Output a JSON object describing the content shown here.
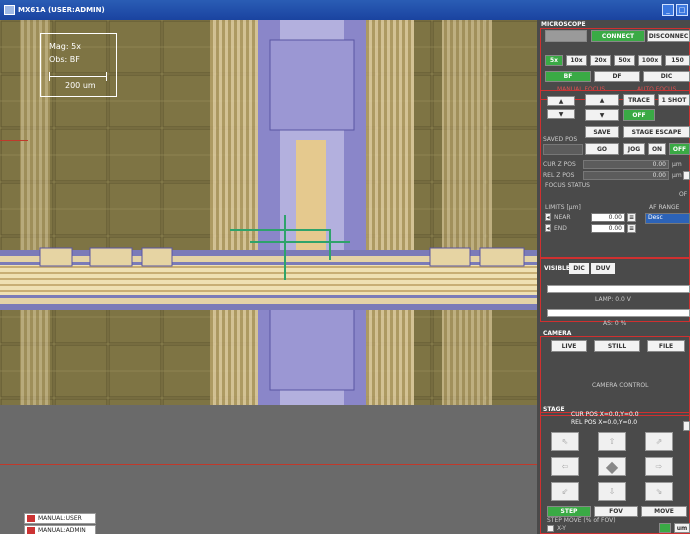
{
  "window": {
    "title": "MX61A (USER:ADMIN)",
    "buttons": [
      "_",
      "□"
    ]
  },
  "overlay": {
    "mag": "Mag: 5x",
    "obs": "Obs: BF",
    "scale": "200  um"
  },
  "modes": [
    "MANUAL:USER",
    "MANUAL:ADMIN"
  ],
  "microscope": {
    "title": "MICROSCOPE",
    "connect": "CONNECT",
    "disconnect": "DISCONNEC",
    "mags": [
      "5x",
      "10x",
      "20x",
      "50x",
      "100x",
      "150"
    ],
    "obs": [
      "BF",
      "DF",
      "DIC"
    ],
    "manual_focus": "MANUAL FOCUS",
    "auto_focus": "AUTO FOCUS",
    "trace": "TRACE",
    "one_shot": "1 SHOT",
    "off": "OFF",
    "saved_pos": "SAVED POS",
    "save": "SAVE",
    "stage_escape": "STAGE ESCAPE",
    "go": "GO",
    "jog": "JOG",
    "on": "ON",
    "off2": "OFF",
    "cur_z_pos": "CUR Z POS",
    "rel_z_pos": "REL Z POS",
    "cur_z_val": "0.00",
    "rel_z_val": "0.00",
    "unit": "µm",
    "focus_status": "FOCUS STATUS",
    "focus_status_val": "OF",
    "limits": "LIMITS [µm]",
    "near": "NEAR",
    "end": "END",
    "near_val": "0.00",
    "end_val": "0.00",
    "af_range": "AF RANGE",
    "af_range_val": "Desc"
  },
  "illumination": {
    "tabs": [
      "VISIBLE",
      "DIC",
      "DUV"
    ],
    "lamp": "LAMP: 0.0 V",
    "as": "AS: 0 %"
  },
  "camera": {
    "title": "CAMERA",
    "live": "LIVE",
    "still": "STILL",
    "file": "FILE",
    "control": "CAMERA CONTROL"
  },
  "stage": {
    "title": "STAGE",
    "cur_pos": "CUR POS X=0.0,Y=0.0",
    "rel_pos": "REL POS X=0.0,Y=0.0",
    "arrows": [
      "⇖",
      "⇧",
      "⇗",
      "⇦",
      "◆",
      "⇨",
      "⇙",
      "⇩",
      "⇘"
    ],
    "step": "STEP",
    "fov": "FOV",
    "move": "MOVE",
    "step_move": "STEP MOVE (% of FOV)",
    "xy": "X-Y",
    "um": "um"
  }
}
